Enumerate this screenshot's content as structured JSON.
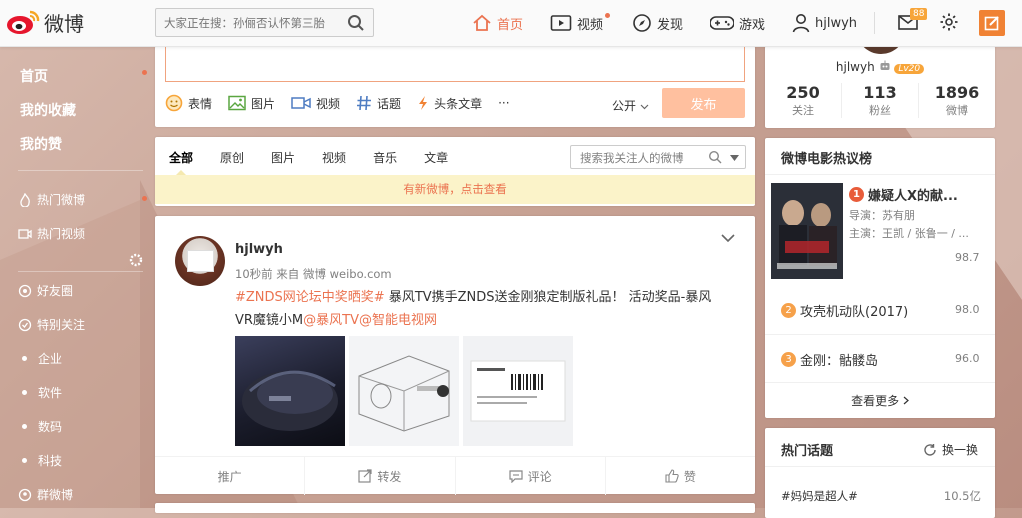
{
  "brand": {
    "name": "微博",
    "logo_icon": "weibo-logo-icon"
  },
  "colors": {
    "accent": "#eb7350",
    "badge": "#f7a53a",
    "notice_bg": "#fbf3c9"
  },
  "search": {
    "placeholder": "大家正在搜：孙俪否认怀第三胎"
  },
  "nav": {
    "home": "首页",
    "video": "视频",
    "discover": "发现",
    "game": "游戏",
    "username": "hjlwyh",
    "message_badge": "88"
  },
  "sidebar": {
    "primary": [
      "首页",
      "我的收藏",
      "我的赞"
    ],
    "hot": [
      "热门微博",
      "热门视频"
    ],
    "groups": [
      "好友圈",
      "特别关注"
    ],
    "subgroups": [
      "企业",
      "软件",
      "数码",
      "科技"
    ],
    "group_weibo": "群微博"
  },
  "publisher": {
    "tools": [
      "表情",
      "图片",
      "视频",
      "话题",
      "头条文章"
    ],
    "more": "···",
    "privacy": "公开",
    "publish": "发布"
  },
  "feed": {
    "tabs": [
      "全部",
      "原创",
      "图片",
      "视频",
      "音乐",
      "文章"
    ],
    "search_placeholder": "搜索我关注人的微博",
    "notice": "有新微博，点击查看"
  },
  "post": {
    "author": "hjlwyh",
    "meta": "10秒前 来自 微博 weibo.com",
    "hashtag": "#ZNDS网论坛中奖晒奖#",
    "text1": " 暴风TV携手ZNDS送金刚狼定制版礼品！ 活动奖品-暴风",
    "text2": "VR魔镜小M",
    "mention1": "@暴风TV",
    "mention2": "@智能电视网",
    "actions": [
      "推广",
      "转发",
      "评论",
      "赞"
    ]
  },
  "profile": {
    "name": "hjlwyh",
    "level": "Lv20",
    "stats": [
      {
        "num": "250",
        "label": "关注"
      },
      {
        "num": "113",
        "label": "粉丝"
      },
      {
        "num": "1896",
        "label": "微博"
      }
    ]
  },
  "movies": {
    "title": "微博电影热议榜",
    "items": [
      {
        "rank": "1",
        "name": "嫌疑人X的献...",
        "director": "导演：苏有朋",
        "cast": "主演：王凯 / 张鲁一 / ...",
        "score": "98.7"
      },
      {
        "rank": "2",
        "name": "攻壳机动队(2017)",
        "score": "98.0"
      },
      {
        "rank": "3",
        "name": "金刚：骷髅岛",
        "score": "96.0"
      }
    ],
    "more": "查看更多"
  },
  "topics": {
    "title": "热门话题",
    "refresh": "换一换",
    "items": [
      {
        "name": "#妈妈是超人#",
        "value": "10.5亿"
      }
    ]
  }
}
